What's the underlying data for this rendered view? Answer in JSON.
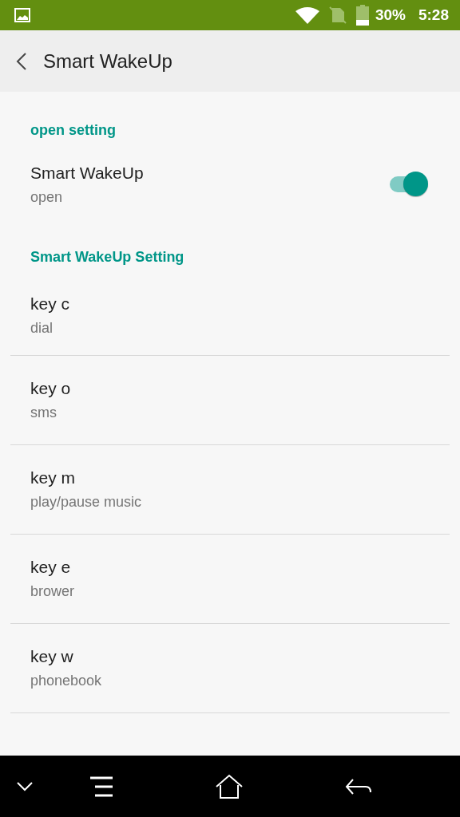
{
  "status_bar": {
    "battery": "30%",
    "time": "5:28"
  },
  "header": {
    "title": "Smart WakeUp"
  },
  "sections": [
    {
      "title": "open setting",
      "items": [
        {
          "kind": "switch",
          "title": "Smart WakeUp",
          "subtitle": "open",
          "on": true
        }
      ]
    },
    {
      "title": "Smart WakeUp Setting",
      "items": [
        {
          "kind": "plain",
          "title": "key c",
          "subtitle": "dial"
        },
        {
          "kind": "plain",
          "title": "key o",
          "subtitle": "sms"
        },
        {
          "kind": "plain",
          "title": "key m",
          "subtitle": "play/pause music"
        },
        {
          "kind": "plain",
          "title": "key e",
          "subtitle": "brower"
        },
        {
          "kind": "plain",
          "title": "key w",
          "subtitle": "phonebook"
        }
      ]
    }
  ]
}
